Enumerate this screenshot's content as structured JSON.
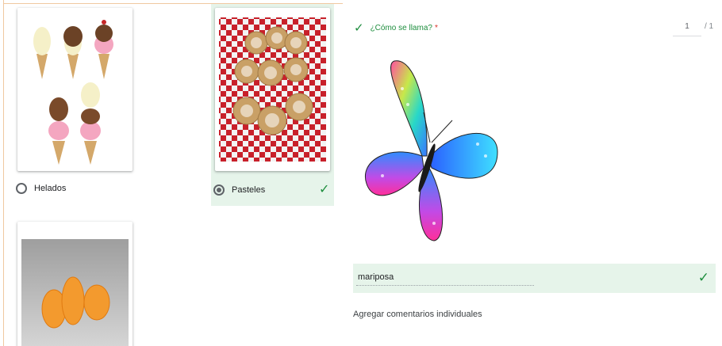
{
  "question_left": {
    "options": [
      {
        "label": "Helados",
        "selected": false,
        "correct": false
      },
      {
        "label": "Pasteles",
        "selected": true,
        "correct": true
      }
    ],
    "images": [
      "ice-cream-cones",
      "empanadas-pastries",
      "orange-gummies"
    ]
  },
  "question_right": {
    "title": "¿Cómo se llama?",
    "required_mark": "*",
    "score": "1",
    "score_total": "/ 1",
    "image": "butterfly",
    "answer": "mariposa",
    "feedback_link": "Agregar comentarios individuales"
  },
  "icons": {
    "correct_check": "✓"
  },
  "colors": {
    "correct_green": "#1e8e3e",
    "selected_bg": "#e6f4ea",
    "required_red": "#d93025"
  }
}
